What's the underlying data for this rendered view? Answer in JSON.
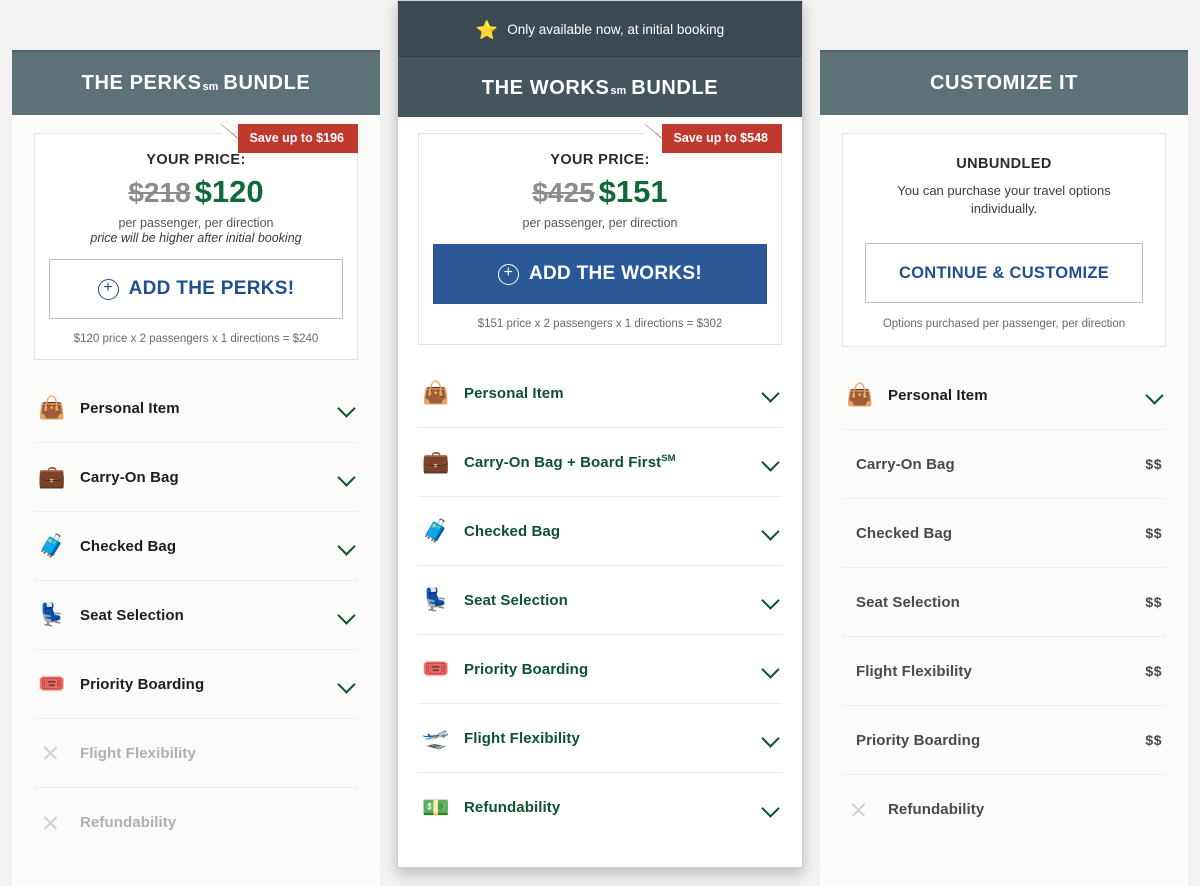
{
  "cards": [
    {
      "id": "perks",
      "header": {
        "title_main": "THE PERKS",
        "title_sm": "sm",
        "title_tail": "BUNDLE"
      },
      "ribbon": "Save up to $196",
      "price": {
        "label": "YOUR PRICE:",
        "old": "$218",
        "new": "$120",
        "per_note": "per passenger, per direction",
        "italic_note": "price will be higher after initial booking"
      },
      "cta": {
        "label": "ADD THE PERKS!",
        "icon": "plus-circle-icon",
        "style": "outline"
      },
      "foot_note": "$120 price x 2 passengers x 1 directions = $240",
      "features": [
        {
          "icon": "handbag-icon",
          "glyph": "👜",
          "label": "Personal Item",
          "state": "included",
          "right": "chevron"
        },
        {
          "icon": "briefcase-icon",
          "glyph": "💼",
          "label": "Carry-On Bag",
          "state": "included",
          "right": "chevron"
        },
        {
          "icon": "suitcase-icon",
          "glyph": "🧳",
          "label": "Checked Bag",
          "state": "included",
          "right": "chevron"
        },
        {
          "icon": "seat-icon",
          "glyph": "💺",
          "label": "Seat Selection",
          "state": "included",
          "right": "chevron"
        },
        {
          "icon": "boarding-pass-icon",
          "glyph": "🎟️",
          "label": "Priority Boarding",
          "state": "included",
          "right": "chevron"
        },
        {
          "icon": "x-icon",
          "glyph": "",
          "label": "Flight Flexibility",
          "state": "excluded",
          "right": "none"
        },
        {
          "icon": "x-icon",
          "glyph": "",
          "label": "Refundability",
          "state": "excluded",
          "right": "none"
        }
      ]
    },
    {
      "id": "works",
      "promo": {
        "text": "Only available now, at initial booking",
        "icon": "star-icon",
        "glyph": "⭐"
      },
      "header": {
        "title_main": "THE WORKS",
        "title_sm": "sm",
        "title_tail": "BUNDLE"
      },
      "ribbon": "Save up to $548",
      "price": {
        "label": "YOUR PRICE:",
        "old": "$425",
        "new": "$151",
        "per_note": "per passenger, per direction",
        "italic_note": ""
      },
      "cta": {
        "label": "ADD THE WORKS!",
        "icon": "plus-circle-icon",
        "style": "solid"
      },
      "foot_note": "$151 price x 2 passengers x 1 directions = $302",
      "features": [
        {
          "icon": "handbag-icon",
          "glyph": "👜",
          "label": "Personal Item",
          "sup": "",
          "state": "included",
          "right": "chevron"
        },
        {
          "icon": "briefcase-icon",
          "glyph": "💼",
          "label": "Carry-On Bag + Board First",
          "sup": "SM",
          "state": "included",
          "right": "chevron"
        },
        {
          "icon": "suitcase-icon",
          "glyph": "🧳",
          "label": "Checked Bag",
          "sup": "",
          "state": "included",
          "right": "chevron"
        },
        {
          "icon": "seat-icon",
          "glyph": "💺",
          "label": "Seat Selection",
          "sup": "",
          "state": "included",
          "right": "chevron"
        },
        {
          "icon": "boarding-pass-icon",
          "glyph": "🎟️",
          "label": "Priority Boarding",
          "sup": "",
          "state": "included",
          "right": "chevron"
        },
        {
          "icon": "departing-plane-icon",
          "glyph": "🛫",
          "label": "Flight Flexibility",
          "sup": "",
          "state": "included",
          "right": "chevron"
        },
        {
          "icon": "money-icon",
          "glyph": "💵",
          "label": "Refundability",
          "sup": "",
          "state": "included",
          "right": "chevron"
        }
      ]
    },
    {
      "id": "custom",
      "header": {
        "title_main": "CUSTOMIZE IT",
        "title_sm": "",
        "title_tail": ""
      },
      "ribbon": "",
      "unbundled": {
        "title": "UNBUNDLED",
        "desc": "You can purchase your travel options individually."
      },
      "cta": {
        "label": "CONTINUE & CUSTOMIZE",
        "icon": "",
        "style": "outline"
      },
      "foot_note": "Options purchased per passenger, per direction",
      "features": [
        {
          "icon": "handbag-icon",
          "glyph": "👜",
          "label": "Personal Item",
          "state": "included",
          "right": "chevron"
        },
        {
          "icon": "",
          "glyph": "",
          "label": "Carry-On Bag",
          "state": "paid",
          "right": "$$"
        },
        {
          "icon": "",
          "glyph": "",
          "label": "Checked Bag",
          "state": "paid",
          "right": "$$"
        },
        {
          "icon": "",
          "glyph": "",
          "label": "Seat Selection",
          "state": "paid",
          "right": "$$"
        },
        {
          "icon": "",
          "glyph": "",
          "label": "Flight Flexibility",
          "state": "paid",
          "right": "$$"
        },
        {
          "icon": "",
          "glyph": "",
          "label": "Priority Boarding",
          "state": "paid",
          "right": "$$"
        },
        {
          "icon": "x-icon",
          "glyph": "",
          "label": "Refundability",
          "state": "excluded",
          "right": "none"
        }
      ]
    }
  ],
  "colors": {
    "header_bg": "#5d7179",
    "featured_header_bg": "#44555e",
    "promo_bg": "#3b4a52",
    "ribbon_red": "#c0392f",
    "price_green": "#11693a",
    "cta_blue": "#2b5896",
    "label_green": "#0f5132",
    "page_bg": "#f2f2f0"
  }
}
